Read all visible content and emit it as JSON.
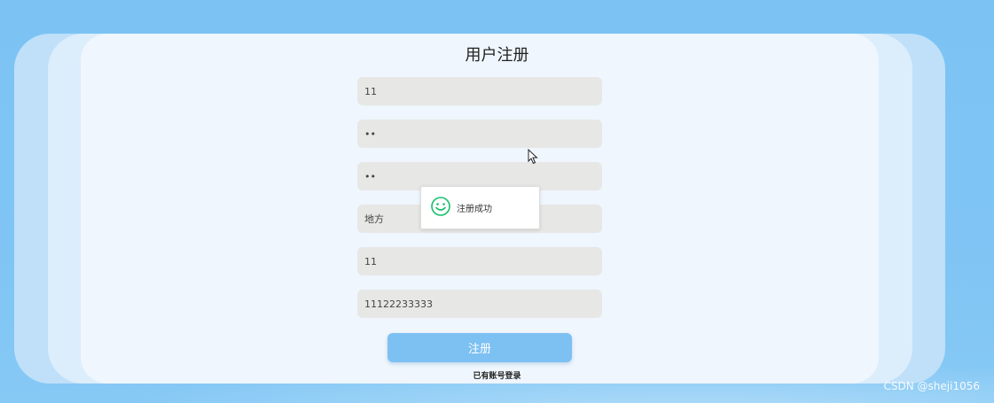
{
  "page": {
    "title": "用户注册"
  },
  "form": {
    "fields": [
      {
        "value": "11"
      },
      {
        "value": "••"
      },
      {
        "value": "••"
      },
      {
        "value": "地方"
      },
      {
        "value": "11"
      },
      {
        "value": "11122233333"
      }
    ],
    "submit_label": "注册",
    "login_link": "已有账号登录"
  },
  "toast": {
    "message": "注册成功",
    "icon": "smile-icon",
    "color": "#19be6b"
  },
  "watermark": "CSDN @sheji1056",
  "colors": {
    "background": "#7cc3f4",
    "card": "#eff6fd",
    "button": "#7dc0f2",
    "field": "#e7e7e6"
  }
}
